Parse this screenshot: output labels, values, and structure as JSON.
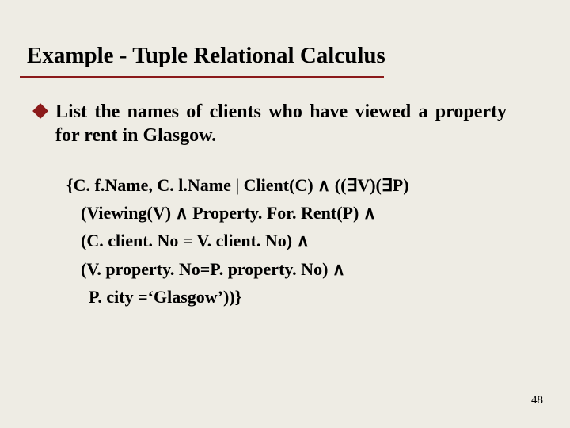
{
  "title": "Example - Tuple Relational Calculus",
  "bullet": "List the names of clients who have viewed a property for rent in Glasgow.",
  "formula": {
    "l1": "{C. f.Name, C. l.Name | Client(C) ∧ ((∃V)(∃P)",
    "l2": "(Viewing(V) ∧ Property. For. Rent(P) ∧",
    "l3": "(C. client. No = V. client. No) ∧",
    "l4": "(V. property. No=P. property. No) ∧",
    "l5": "P. city =‘Glasgow’))}"
  },
  "page": "48"
}
